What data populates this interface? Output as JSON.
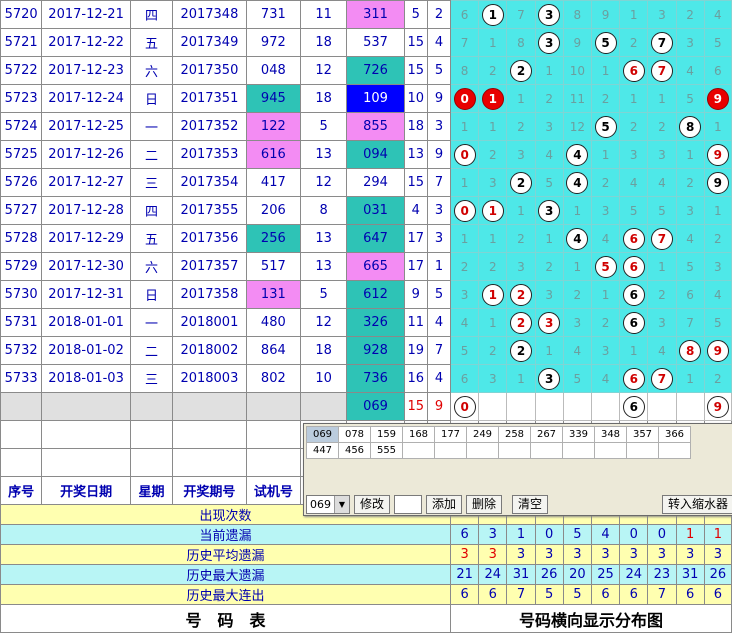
{
  "rows": [
    {
      "seq": "5720",
      "date": "2017-12-21",
      "week": "四",
      "issue": "2017348",
      "prize": "731",
      "sum": "11",
      "trial": "311",
      "trial_color": "pink",
      "span": "5",
      "k": "2",
      "dist": [
        "6",
        "c1",
        "7",
        "c3",
        "8",
        "9",
        "1",
        "3",
        "2",
        "4"
      ]
    },
    {
      "seq": "5721",
      "date": "2017-12-22",
      "week": "五",
      "issue": "2017349",
      "prize": "972",
      "sum": "18",
      "trial": "537",
      "trial_color": "",
      "span": "15",
      "k": "4",
      "dist": [
        "7",
        "1",
        "8",
        "c3",
        "9",
        "c5",
        "2",
        "c7",
        "3",
        "5"
      ]
    },
    {
      "seq": "5722",
      "date": "2017-12-23",
      "week": "六",
      "issue": "2017350",
      "prize": "048",
      "sum": "12",
      "trial": "726",
      "trial_color": "teal",
      "span": "15",
      "k": "5",
      "dist": [
        "8",
        "2",
        "c2",
        "1",
        "10",
        "1",
        "r6",
        "r7",
        "4",
        "6"
      ]
    },
    {
      "seq": "5723",
      "date": "2017-12-24",
      "week": "日",
      "issue": "2017351",
      "prize": "945",
      "prize_color": "teal",
      "sum": "18",
      "trial": "109",
      "trial_color": "blue",
      "span": "10",
      "k": "9",
      "dist": [
        "R0",
        "R1",
        "1",
        "2",
        "11",
        "2",
        "1",
        "1",
        "5",
        "R9"
      ]
    },
    {
      "seq": "5724",
      "date": "2017-12-25",
      "week": "一",
      "issue": "2017352",
      "prize": "122",
      "prize_color": "pink",
      "sum": "5",
      "trial": "855",
      "trial_color": "pink",
      "span": "18",
      "k": "3",
      "dist": [
        "1",
        "1",
        "2",
        "3",
        "12",
        "c5",
        "2",
        "2",
        "c8",
        "1"
      ]
    },
    {
      "seq": "5725",
      "date": "2017-12-26",
      "week": "二",
      "issue": "2017353",
      "prize": "616",
      "prize_color": "pink",
      "sum": "13",
      "trial": "094",
      "trial_color": "teal",
      "span": "13",
      "k": "9",
      "dist": [
        "r0",
        "2",
        "3",
        "4",
        "c4",
        "1",
        "3",
        "3",
        "1",
        "r9"
      ]
    },
    {
      "seq": "5726",
      "date": "2017-12-27",
      "week": "三",
      "issue": "2017354",
      "prize": "417",
      "sum": "12",
      "trial": "294",
      "trial_color": "",
      "span": "15",
      "k": "7",
      "dist": [
        "1",
        "3",
        "c2",
        "5",
        "c4",
        "2",
        "4",
        "4",
        "2",
        "c9"
      ]
    },
    {
      "seq": "5727",
      "date": "2017-12-28",
      "week": "四",
      "issue": "2017355",
      "prize": "206",
      "sum": "8",
      "trial": "031",
      "trial_color": "teal",
      "span": "4",
      "k": "3",
      "dist": [
        "r0",
        "r1",
        "1",
        "c3",
        "1",
        "3",
        "5",
        "5",
        "3",
        "1"
      ]
    },
    {
      "seq": "5728",
      "date": "2017-12-29",
      "week": "五",
      "issue": "2017356",
      "prize": "256",
      "prize_color": "teal",
      "sum": "13",
      "trial": "647",
      "trial_color": "teal",
      "span": "17",
      "k": "3",
      "dist": [
        "1",
        "1",
        "2",
        "1",
        "c4",
        "4",
        "r6",
        "r7",
        "4",
        "2"
      ]
    },
    {
      "seq": "5729",
      "date": "2017-12-30",
      "week": "六",
      "issue": "2017357",
      "prize": "517",
      "sum": "13",
      "trial": "665",
      "trial_color": "pink",
      "span": "17",
      "k": "1",
      "dist": [
        "2",
        "2",
        "3",
        "2",
        "1",
        "r5",
        "r6",
        "1",
        "5",
        "3"
      ]
    },
    {
      "seq": "5730",
      "date": "2017-12-31",
      "week": "日",
      "issue": "2017358",
      "prize": "131",
      "prize_color": "pink",
      "sum": "5",
      "trial": "612",
      "trial_color": "teal",
      "span": "9",
      "k": "5",
      "dist": [
        "3",
        "r1",
        "r2",
        "3",
        "2",
        "1",
        "c6",
        "2",
        "6",
        "4"
      ]
    },
    {
      "seq": "5731",
      "date": "2018-01-01",
      "week": "一",
      "issue": "2018001",
      "prize": "480",
      "sum": "12",
      "trial": "326",
      "trial_color": "teal",
      "span": "11",
      "k": "4",
      "dist": [
        "4",
        "1",
        "r2",
        "r3",
        "3",
        "2",
        "c6",
        "3",
        "7",
        "5"
      ]
    },
    {
      "seq": "5732",
      "date": "2018-01-02",
      "week": "二",
      "issue": "2018002",
      "prize": "864",
      "sum": "18",
      "trial": "928",
      "trial_color": "teal",
      "span": "19",
      "k": "7",
      "dist": [
        "5",
        "2",
        "c2",
        "1",
        "4",
        "3",
        "1",
        "4",
        "r8",
        "r9"
      ]
    },
    {
      "seq": "5733",
      "date": "2018-01-03",
      "week": "三",
      "issue": "2018003",
      "prize": "802",
      "sum": "10",
      "trial": "736",
      "trial_color": "teal",
      "span": "16",
      "k": "4",
      "dist": [
        "6",
        "3",
        "1",
        "c3",
        "5",
        "4",
        "r6",
        "r7",
        "1",
        "2"
      ]
    }
  ],
  "predict": {
    "trial": "069",
    "span": "15",
    "k": "9",
    "dist": [
      "r0",
      "",
      "",
      "",
      "",
      "",
      "c6",
      "",
      "",
      "r9"
    ]
  },
  "headers": {
    "seq": "序号",
    "date": "开奖日期",
    "week": "星期",
    "issue": "开奖期号",
    "trial": "试机号"
  },
  "stats": [
    {
      "label": "出现次数",
      "values": [
        "",
        "",
        "",
        "",
        "",
        "",
        "",
        "",
        "",
        ""
      ]
    },
    {
      "label": "当前遗漏",
      "values": [
        "6",
        "3",
        "1",
        "0",
        "5",
        "4",
        "0",
        "0",
        "1",
        "1"
      ],
      "red": [
        8,
        9
      ]
    },
    {
      "label": "历史平均遗漏",
      "values": [
        "3",
        "3",
        "3",
        "3",
        "3",
        "3",
        "3",
        "3",
        "3",
        "3"
      ],
      "red": [
        0,
        1
      ]
    },
    {
      "label": "历史最大遗漏",
      "values": [
        "21",
        "24",
        "31",
        "26",
        "20",
        "25",
        "24",
        "23",
        "31",
        "26"
      ]
    },
    {
      "label": "历史最大连出",
      "values": [
        "6",
        "6",
        "7",
        "5",
        "5",
        "6",
        "6",
        "7",
        "6",
        "6"
      ]
    }
  ],
  "footer": {
    "left": "号　码　表",
    "right": "号码横向显示分布图"
  },
  "panel": {
    "codes_row1": [
      "069",
      "078",
      "159",
      "168",
      "177",
      "249",
      "258",
      "267",
      "339",
      "348",
      "357",
      "366"
    ],
    "codes_row2": [
      "447",
      "456",
      "555",
      "",
      "",
      "",
      "",
      "",
      "",
      "",
      "",
      ""
    ],
    "selected": "069",
    "btn_modify": "修改",
    "btn_add": "添加",
    "btn_delete": "删除",
    "btn_clear": "清空",
    "btn_transfer": "转入缩水器"
  }
}
